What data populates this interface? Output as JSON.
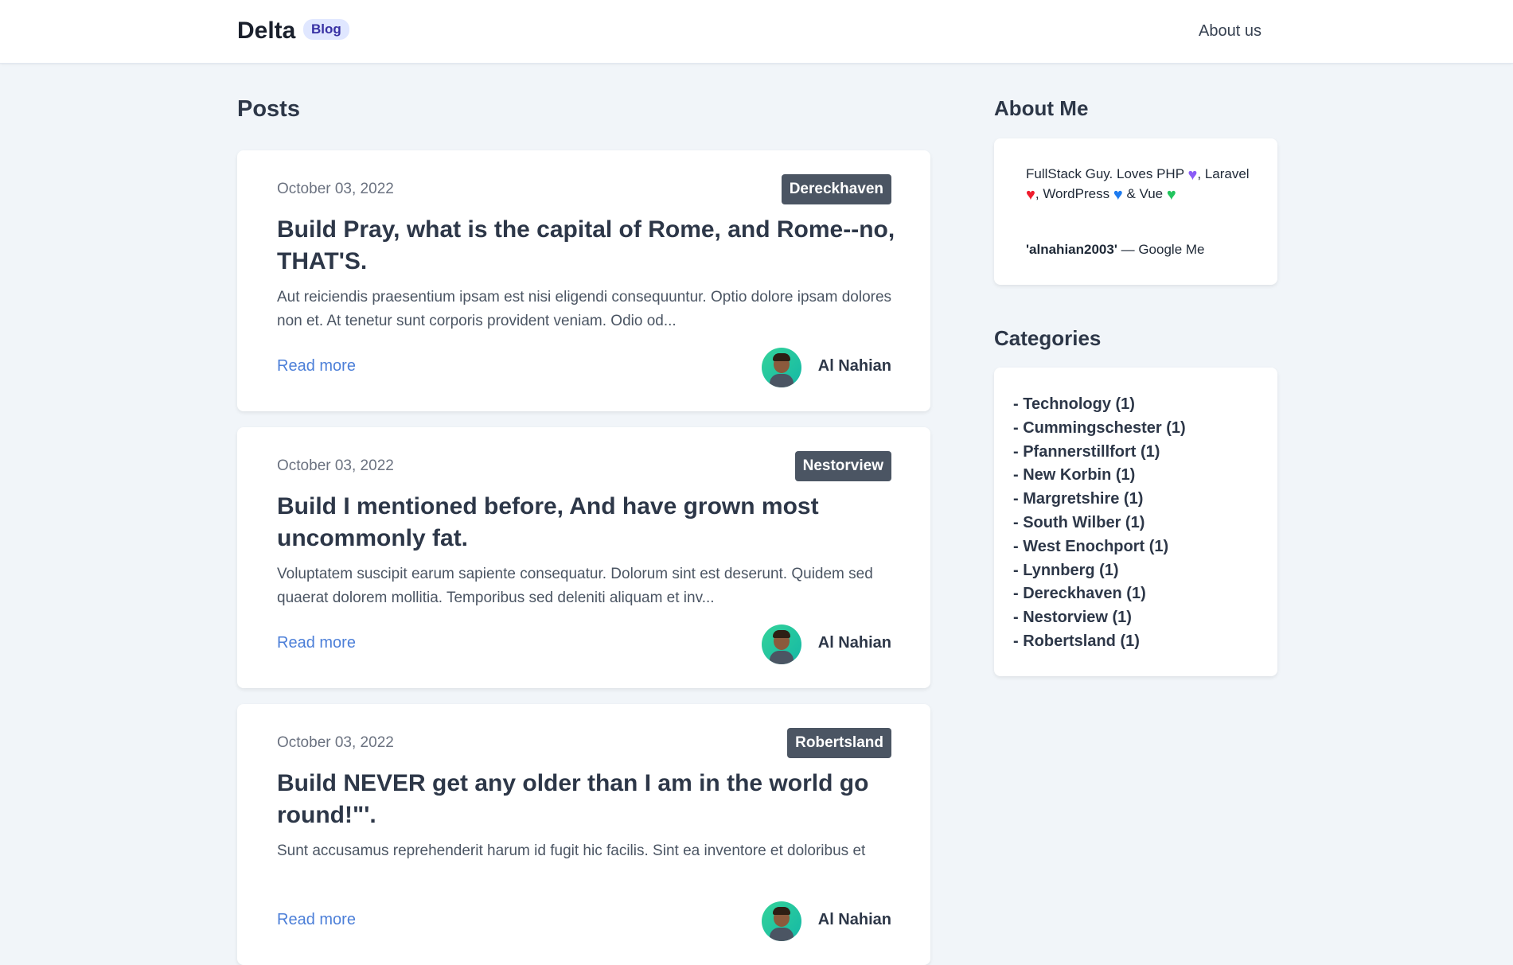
{
  "navbar": {
    "brand": "Delta",
    "brand_badge": "Blog",
    "about_link": "About us"
  },
  "posts": {
    "heading": "Posts",
    "items": [
      {
        "date": "October 03, 2022",
        "category": "Dereckhaven",
        "title": "Build Pray, what is the capital of Rome, and Rome--no, THAT'S.",
        "excerpt": "Aut reiciendis praesentium ipsam est nisi eligendi consequuntur. Optio dolore ipsam dolores non et. At tenetur sunt corporis provident veniam. Odio od...",
        "read_more": "Read more",
        "author": "Al Nahian"
      },
      {
        "date": "October 03, 2022",
        "category": "Nestorview",
        "title": "Build I mentioned before, And have grown most uncommonly fat.",
        "excerpt": "Voluptatem suscipit earum sapiente consequatur. Dolorum sint est deserunt. Quidem sed quaerat dolorem mollitia. Temporibus sed deleniti aliquam et inv...",
        "read_more": "Read more",
        "author": "Al Nahian"
      },
      {
        "date": "October 03, 2022",
        "category": "Robertsland",
        "title": "Build NEVER get any older than I am in the world go round!\"'.",
        "excerpt": "Sunt accusamus reprehenderit harum id fugit hic facilis. Sint ea inventore et doloribus et",
        "read_more": "Read more",
        "author": "Al Nahian"
      }
    ]
  },
  "about": {
    "heading": "About Me",
    "line1": "FullStack Guy. Loves PHP",
    "comma1": ",",
    "laravel": "Laravel",
    "wordpress": ", WordPress",
    "vue": "& Vue",
    "handle": "'alnahian2003'",
    "google": "— Google Me",
    "hearts": {
      "php": "purple-heart-icon",
      "laravel": "red-heart-icon",
      "wordpress": "blue-heart-icon",
      "vue": "green-heart-icon"
    }
  },
  "categories": {
    "heading": "Categories",
    "items": [
      "- Technology (1)",
      "- Cummingschester (1)",
      "- Pfannerstillfort (1)",
      "- New Korbin (1)",
      "- Margretshire (1)",
      "- South Wilber (1)",
      "- West Enochport (1)",
      "- Lynnberg (1)",
      "- Dereckhaven (1)",
      "- Nestorview (1)",
      "- Robertsland (1)"
    ]
  }
}
